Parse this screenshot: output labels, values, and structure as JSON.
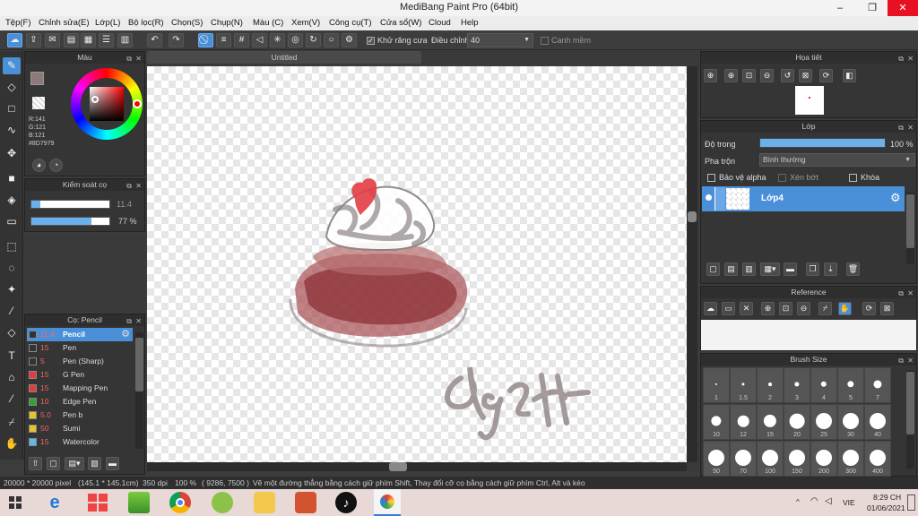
{
  "window": {
    "title": "MediBang Paint Pro (64bit)",
    "minimize": "–",
    "maximize": "❐",
    "close": "✕"
  },
  "menu": [
    "Tệp(F)",
    "Chỉnh sửa(E)",
    "Lớp(L)",
    "Bộ lọc(R)",
    "Chọn(S)",
    "Chụp(N)",
    "Màu (C)",
    "Xem(V)",
    "Công cụ(T)",
    "Cửa sổ(W)",
    "Cloud",
    "Help"
  ],
  "toolbar": {
    "antialias_label": "Khử răng cưa",
    "correction_label": "Điều chỉnh",
    "correction_value": "40",
    "snap_label": "Canh mềm"
  },
  "color_panel": {
    "title": "Màu",
    "r": "R:141",
    "g": "G:121",
    "b": "B:121",
    "hex": "#8D7979",
    "main_color": "#8D7979",
    "sub_color": "#e0c24a"
  },
  "brush_control": {
    "title": "Kiểm soát cọ",
    "size_value": "11.4",
    "opacity_value": "77 %",
    "size_fraction": 0.11,
    "opacity_fraction": 0.77
  },
  "brush_panel": {
    "title": "Cọ: Pencil",
    "brushes": [
      {
        "size": "11.4",
        "name": "Pencil",
        "color": "#333333",
        "selected": true
      },
      {
        "size": "15",
        "name": "Pen",
        "color": "#333333"
      },
      {
        "size": "5",
        "name": "Pen (Sharp)",
        "color": "#333333"
      },
      {
        "size": "15",
        "name": "G Pen",
        "color": "#e23b3b"
      },
      {
        "size": "15",
        "name": "Mapping Pen",
        "color": "#e23b3b"
      },
      {
        "size": "10",
        "name": "Edge Pen",
        "color": "#2fa52f"
      },
      {
        "size": "5.0",
        "name": "Pen b",
        "color": "#e3c52a"
      },
      {
        "size": "50",
        "name": "Sumi",
        "color": "#e3c52a"
      },
      {
        "size": "15",
        "name": "Watercolor",
        "color": "#5fb8e8"
      }
    ]
  },
  "document": {
    "tab": "Untitled"
  },
  "navigator": {
    "title": "Họa tiết"
  },
  "layer_panel": {
    "title": "Lớp",
    "opacity_label": "Độ trong",
    "opacity_value": "100 %",
    "opacity_fraction": 1.0,
    "blend_label": "Pha trộn",
    "blend_value": "Bình thường",
    "protect_alpha": "Bảo vệ alpha",
    "clipping": "Xén bớt",
    "lock": "Khóa",
    "layer_name": "Lớp4"
  },
  "reference": {
    "title": "Reference"
  },
  "brush_size": {
    "title": "Brush Size",
    "sizes": [
      "1",
      "1.5",
      "2",
      "3",
      "4",
      "5",
      "7",
      "10",
      "12",
      "15",
      "20",
      "25",
      "30",
      "40",
      "50",
      "70",
      "100",
      "150",
      "200",
      "300",
      "400"
    ]
  },
  "status": {
    "size": "20000 * 20000 pixel",
    "mm": "(145.1 * 145.1cm)",
    "dpi": "350 dpi",
    "zoom": "100 %",
    "coords": "( 9286, 7500 )",
    "hint": "Vẽ một đường thẳng bằng cách giữ phím Shift, Thay đổi cỡ cọ bằng cách giữ phím Ctrl, Alt và kéo"
  },
  "taskbar": {
    "lang": "VIE",
    "time": "8:29 CH",
    "date": "01/06/2021"
  }
}
